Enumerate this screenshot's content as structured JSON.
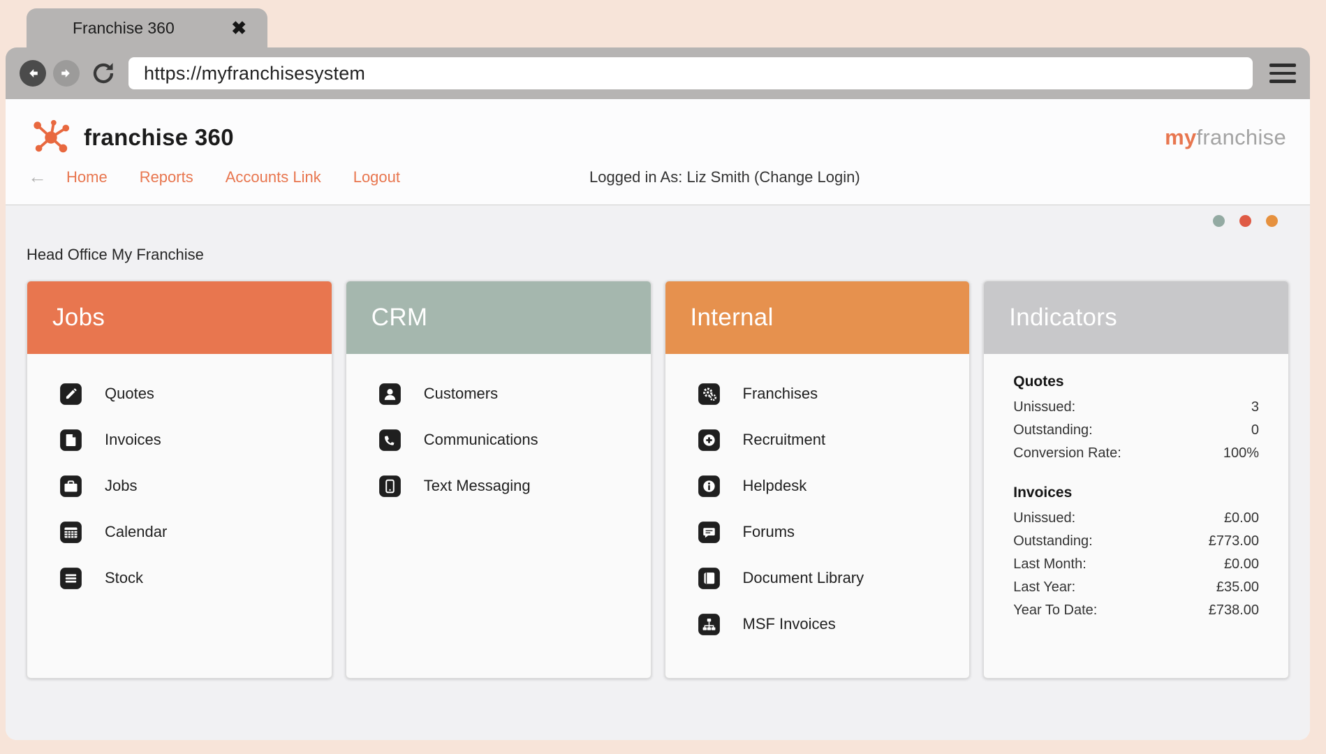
{
  "browser": {
    "tab_title": "Franchise 360",
    "url": "https://myfranchisesystem"
  },
  "header": {
    "brand": "franchise 360",
    "brand_right_my": "my",
    "brand_right_franchise": "franchise",
    "nav": {
      "home": "Home",
      "reports": "Reports",
      "accounts_link": "Accounts Link",
      "logout": "Logout"
    },
    "logged_in_as": "Logged in As: Liz Smith (Change Login)"
  },
  "page": {
    "subtitle": "Head Office My Franchise"
  },
  "cards": {
    "jobs": {
      "title": "Jobs",
      "header_color": "#e8764f",
      "items": [
        {
          "label": "Quotes",
          "icon": "pencil-square-icon"
        },
        {
          "label": "Invoices",
          "icon": "file-icon"
        },
        {
          "label": "Jobs",
          "icon": "briefcase-icon"
        },
        {
          "label": "Calendar",
          "icon": "calendar-icon"
        },
        {
          "label": "Stock",
          "icon": "list-icon"
        }
      ]
    },
    "crm": {
      "title": "CRM",
      "header_color": "#a5b7ae",
      "items": [
        {
          "label": "Customers",
          "icon": "user-icon"
        },
        {
          "label": "Communications",
          "icon": "phone-icon"
        },
        {
          "label": "Text Messaging",
          "icon": "mobile-icon"
        }
      ]
    },
    "internal": {
      "title": "Internal",
      "header_color": "#e6914e",
      "items": [
        {
          "label": "Franchises",
          "icon": "cogs-icon"
        },
        {
          "label": "Recruitment",
          "icon": "plus-circle-icon"
        },
        {
          "label": "Helpdesk",
          "icon": "info-circle-icon"
        },
        {
          "label": "Forums",
          "icon": "comment-icon"
        },
        {
          "label": "Document Library",
          "icon": "book-icon"
        },
        {
          "label": "MSF Invoices",
          "icon": "sitemap-icon"
        }
      ]
    }
  },
  "indicators": {
    "title": "Indicators",
    "header_color": "#c8c8ca",
    "quotes": {
      "heading": "Quotes",
      "rows": [
        {
          "label": "Unissued:",
          "value": "3"
        },
        {
          "label": "Outstanding:",
          "value": "0"
        },
        {
          "label": "Conversion Rate:",
          "value": "100%"
        }
      ]
    },
    "invoices": {
      "heading": "Invoices",
      "rows": [
        {
          "label": "Unissued:",
          "value": "£0.00"
        },
        {
          "label": "Outstanding:",
          "value": "£773.00"
        },
        {
          "label": "Last Month:",
          "value": "£0.00"
        },
        {
          "label": "Last Year:",
          "value": "£35.00"
        },
        {
          "label": "Year To Date:",
          "value": "£738.00"
        }
      ]
    }
  },
  "status_dots": [
    {
      "name": "dot-sage",
      "color": "#93aaa2"
    },
    {
      "name": "dot-red",
      "color": "#df5b45"
    },
    {
      "name": "dot-orange",
      "color": "#e6913e"
    }
  ],
  "colors": {
    "accent_orange": "#e8764f",
    "sage": "#a5b7ae",
    "internal_orange": "#e6914e",
    "indicators_gray": "#c8c8ca",
    "chrome_gray": "#b6b4b3",
    "outer_pink": "#f7e4d9",
    "content_bg": "#f1f1f3"
  }
}
